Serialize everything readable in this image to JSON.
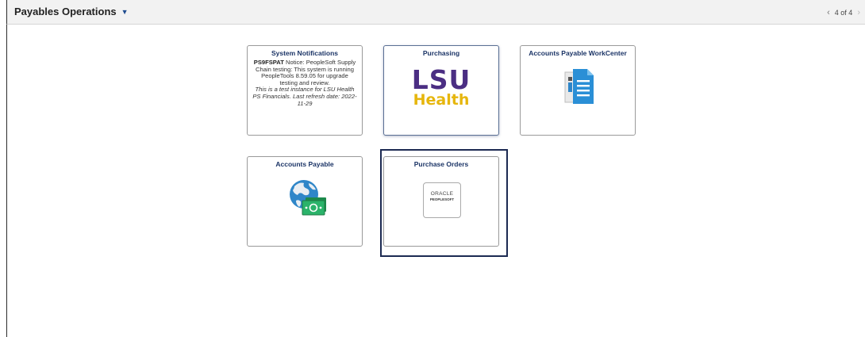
{
  "header": {
    "title": "Payables Operations",
    "dropdown_icon": "caret-down-icon",
    "pager_text": "4 of 4"
  },
  "tiles": {
    "system_notifications": {
      "title": "System Notifications",
      "notice_id": "PS9FSPAT",
      "notice_line": "Notice: PeopleSoft Supply Chain testing: This system is running PeopleTools 8.59.05 for upgrade testing and review.",
      "notice_italic": "This is a test instance for LSU Health PS Financials. Last refresh date: 2022-11-29"
    },
    "purchasing": {
      "title": "Purchasing",
      "logo_top": "LSU",
      "logo_bottom": "Health"
    },
    "ap_workcenter": {
      "title": "Accounts Payable WorkCenter",
      "icon": "documents-icon"
    },
    "accounts_payable": {
      "title": "Accounts Payable",
      "icon": "globe-money-icon"
    },
    "purchase_orders": {
      "title": "Purchase Orders",
      "logo_word": "ORACLE",
      "logo_sub": "PEOPLESOFT"
    }
  },
  "colors": {
    "lsu_purple": "#4b2e83",
    "lsu_gold": "#e6b60d",
    "tile_title": "#1b3466",
    "focus_border": "#1c2a52"
  }
}
